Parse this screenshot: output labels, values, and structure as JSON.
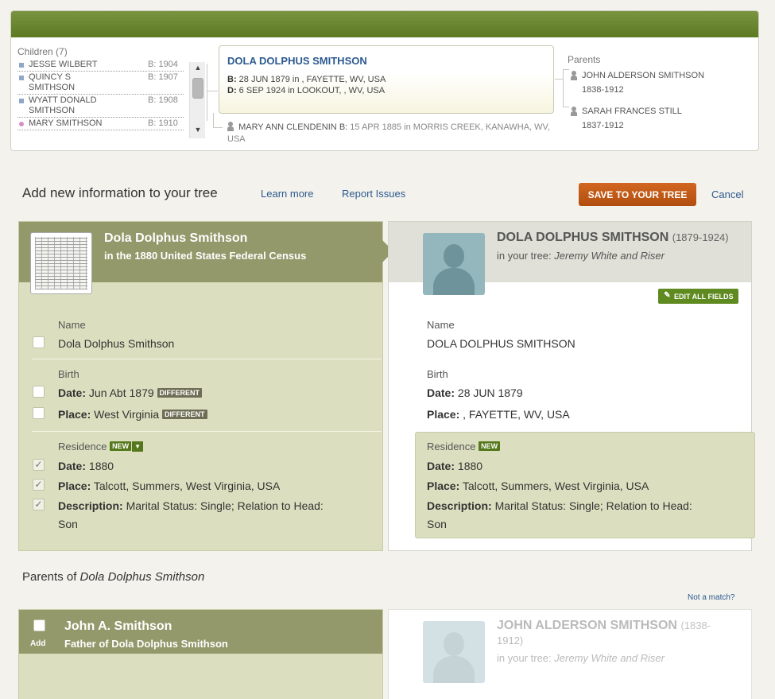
{
  "family": {
    "children_title": "Children (7)",
    "children": [
      {
        "name": "JESSE WILBERT",
        "birth": "B: 1904",
        "sex": "m"
      },
      {
        "name": "QUINCY S SMITHSON",
        "birth": "B: 1907",
        "sex": "m"
      },
      {
        "name": "WYATT DONALD SMITHSON",
        "birth": "B: 1908",
        "sex": "m"
      },
      {
        "name": "MARY SMITHSON",
        "birth": "B: 1910",
        "sex": "f"
      }
    ],
    "focus": {
      "name": "DOLA DOLPHUS SMITHSON",
      "birth_label": "B:",
      "birth": "28 JUN 1879 in , FAYETTE, WV, USA",
      "death_label": "D:",
      "death": "6 SEP 1924 in LOOKOUT, , WV, USA"
    },
    "spouse": {
      "name": "MARY ANN CLENDENIN",
      "birth_label": "B:",
      "birth": "15 APR 1885 in MORRIS CREEK, KANAWHA, WV, USA"
    },
    "parents_title": "Parents",
    "parents": [
      {
        "name": "JOHN ALDERSON SMITHSON",
        "years": "1838-1912"
      },
      {
        "name": "SARAH FRANCES STILL",
        "years": "1837-1912"
      }
    ]
  },
  "header": {
    "title": "Add new information to your tree",
    "learn_more": "Learn more",
    "report_issues": "Report Issues",
    "save": "SAVE TO YOUR TREE",
    "cancel": "Cancel"
  },
  "record": {
    "name": "Dola Dolphus Smithson",
    "source": "in the 1880 United States Federal Census",
    "name_label": "Name",
    "name_value": "Dola Dolphus Smithson",
    "birth_label": "Birth",
    "birth_date_label": "Date:",
    "birth_date": "Jun Abt 1879",
    "birth_place_label": "Place:",
    "birth_place": "West Virginia",
    "different_badge": "DIFFERENT",
    "residence_label": "Residence",
    "new_badge": "NEW",
    "res_date_label": "Date:",
    "res_date": "1880",
    "res_place_label": "Place:",
    "res_place": "Talcott, Summers, West Virginia, USA",
    "res_desc_label": "Description:",
    "res_desc_1": "Marital Status: Single; Relation to Head:",
    "res_desc_2": "Son"
  },
  "tree": {
    "name": "DOLA DOLPHUS SMITHSON",
    "years": "(1879-1924)",
    "in_tree_label": "in your tree:",
    "tree_name": "Jeremy White and Riser",
    "edit_all": "EDIT ALL FIELDS",
    "name_label": "Name",
    "name_value": "DOLA DOLPHUS SMITHSON",
    "birth_label": "Birth",
    "birth_date_label": "Date:",
    "birth_date": "28 JUN 1879",
    "birth_place_label": "Place:",
    "birth_place": ", FAYETTE, WV, USA",
    "residence_label": "Residence",
    "new_badge": "NEW",
    "res_date_label": "Date:",
    "res_date": "1880",
    "res_place_label": "Place:",
    "res_place": "Talcott, Summers, West Virginia, USA",
    "res_desc_label": "Description:",
    "res_desc_1": "Marital Status: Single; Relation to Head:",
    "res_desc_2": "Son"
  },
  "parents_section": {
    "title_prefix": "Parents of",
    "title_name": "Dola Dolphus Smithson",
    "not_match": "Not a match?",
    "father_name": "John A. Smithson",
    "father_sub": "Father of Dola Dolphus Smithson",
    "add_label": "Add",
    "tree_father_name": "JOHN ALDERSON SMITHSON",
    "tree_father_years_1": "(1838-",
    "tree_father_years_2": "1912)",
    "in_tree_label": "in your tree:",
    "tree_name": "Jeremy White and Riser"
  }
}
